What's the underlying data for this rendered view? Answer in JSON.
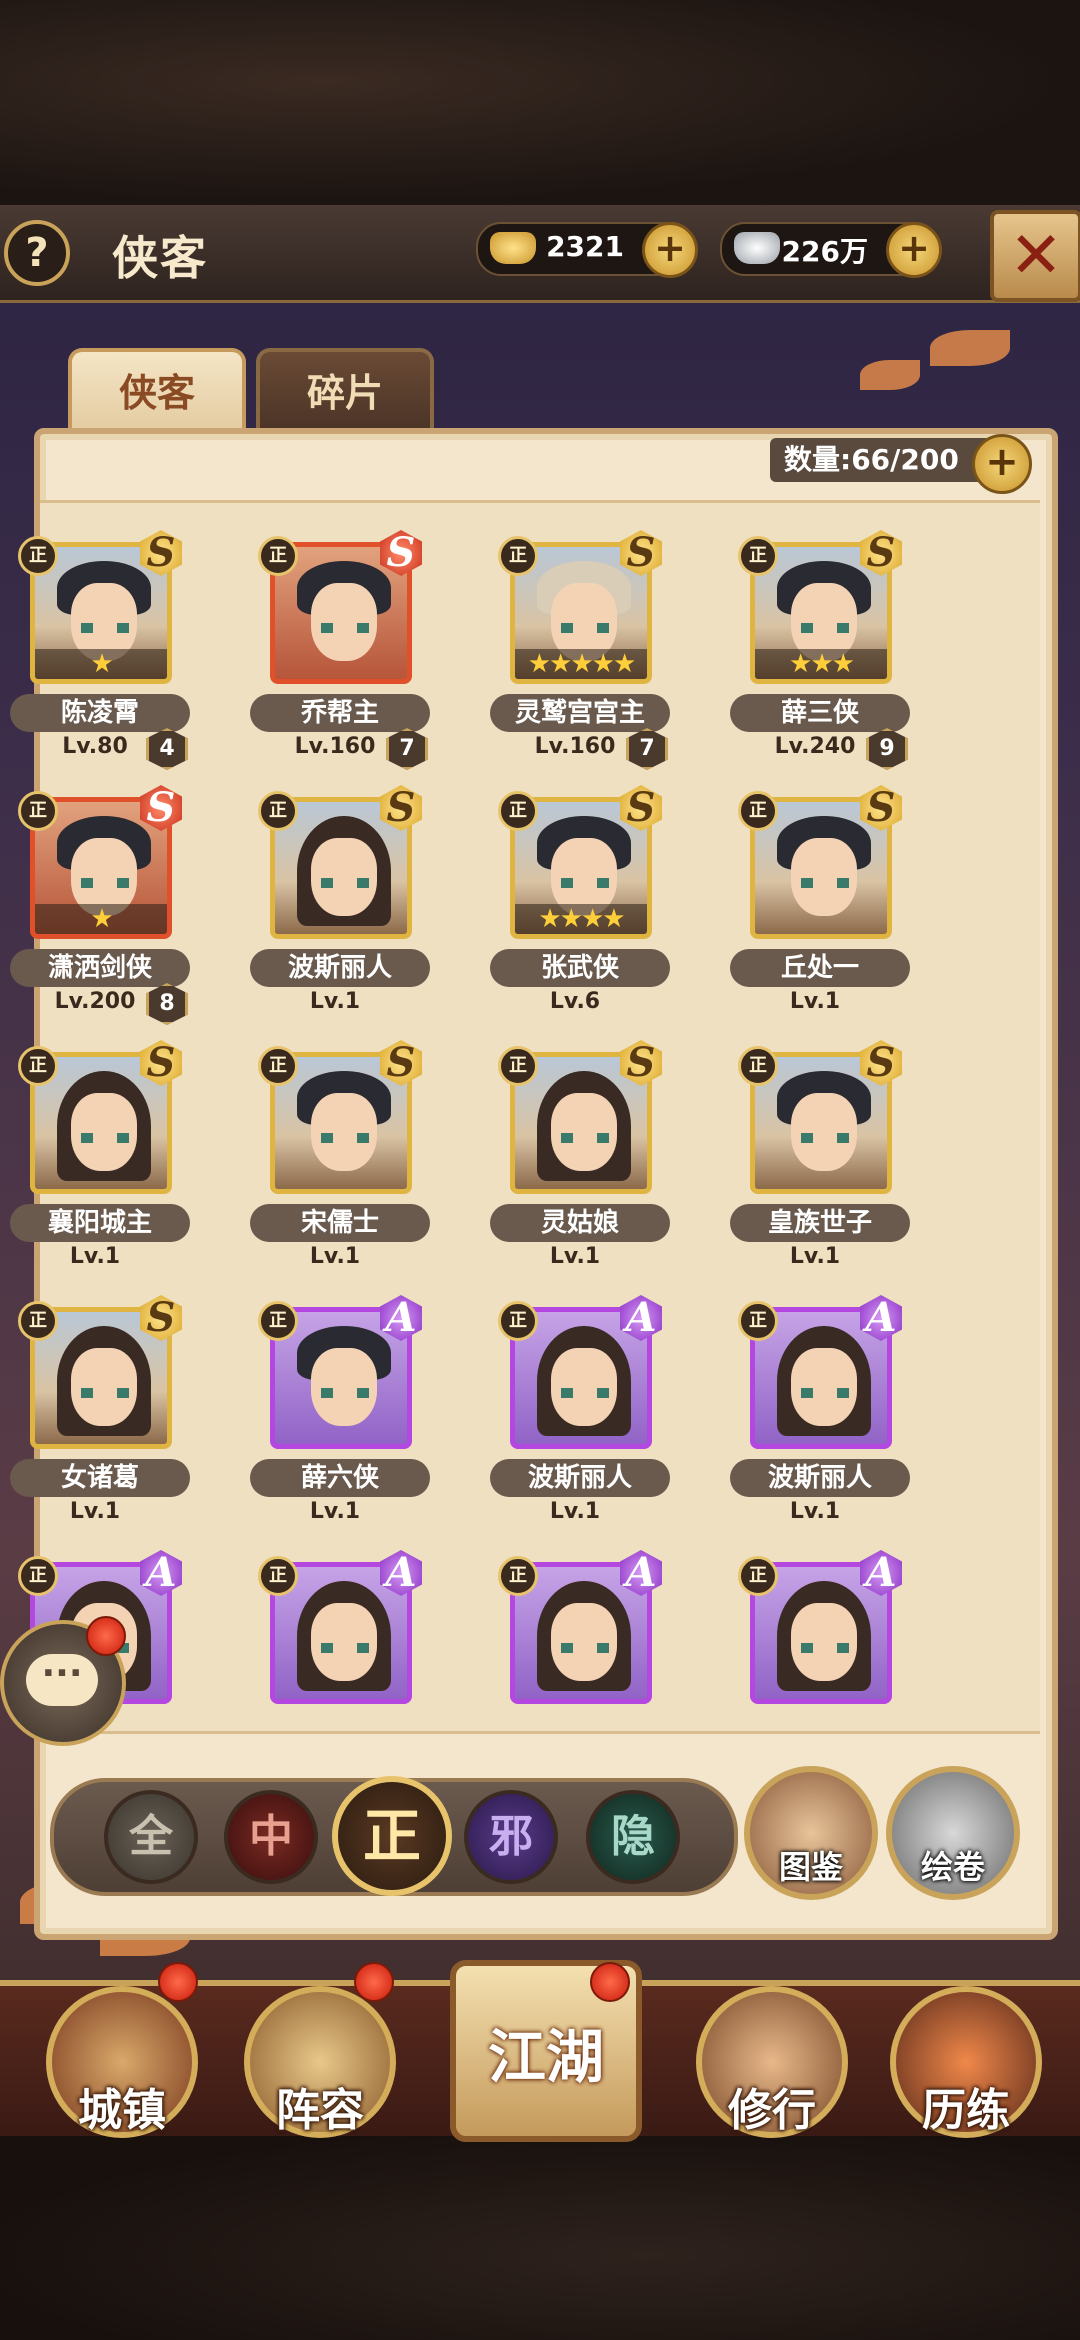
{
  "header": {
    "title": "侠客",
    "help_label": "?",
    "gold": "2321",
    "silver": "226万",
    "close_label": "✕"
  },
  "tabs": [
    {
      "label": "侠客",
      "active": true
    },
    {
      "label": "碎片",
      "active": false
    }
  ],
  "roster": {
    "count_text": "数量:66/200",
    "add_label": "+"
  },
  "heroes": [
    {
      "name": "陈凌霄",
      "level": "Lv.80",
      "count": "4",
      "rank": "S",
      "faction": "正",
      "stars": "★",
      "frame": "gold",
      "hair": "short"
    },
    {
      "name": "乔帮主",
      "level": "Lv.160",
      "count": "7",
      "rank": "S",
      "faction": "正",
      "stars": "",
      "frame": "red",
      "hair": "short"
    },
    {
      "name": "灵鹫宫宫主",
      "level": "Lv.160",
      "count": "7",
      "rank": "S",
      "faction": "正",
      "stars": "★★★★★",
      "frame": "gold",
      "hair": "bald"
    },
    {
      "name": "薛三侠",
      "level": "Lv.240",
      "count": "9",
      "rank": "S",
      "faction": "正",
      "stars": "★★★",
      "frame": "gold",
      "hair": "short"
    },
    {
      "name": "潇洒剑侠",
      "level": "Lv.200",
      "count": "8",
      "rank": "S",
      "faction": "正",
      "stars": "★",
      "frame": "red",
      "hair": "short"
    },
    {
      "name": "波斯丽人",
      "level": "Lv.1",
      "count": "",
      "rank": "S",
      "faction": "正",
      "stars": "",
      "frame": "gold",
      "hair": "long"
    },
    {
      "name": "张武侠",
      "level": "Lv.6",
      "count": "",
      "rank": "S",
      "faction": "正",
      "stars": "★★★★",
      "frame": "gold",
      "hair": "short"
    },
    {
      "name": "丘处一",
      "level": "Lv.1",
      "count": "",
      "rank": "S",
      "faction": "正",
      "stars": "",
      "frame": "gold",
      "hair": "short"
    },
    {
      "name": "襄阳城主",
      "level": "Lv.1",
      "count": "",
      "rank": "S",
      "faction": "正",
      "stars": "",
      "frame": "gold",
      "hair": "long"
    },
    {
      "name": "宋儒士",
      "level": "Lv.1",
      "count": "",
      "rank": "S",
      "faction": "正",
      "stars": "",
      "frame": "gold",
      "hair": "short"
    },
    {
      "name": "灵姑娘",
      "level": "Lv.1",
      "count": "",
      "rank": "S",
      "faction": "正",
      "stars": "",
      "frame": "gold",
      "hair": "long"
    },
    {
      "name": "皇族世子",
      "level": "Lv.1",
      "count": "",
      "rank": "S",
      "faction": "正",
      "stars": "",
      "frame": "gold",
      "hair": "short"
    },
    {
      "name": "女诸葛",
      "level": "Lv.1",
      "count": "",
      "rank": "S",
      "faction": "正",
      "stars": "",
      "frame": "gold",
      "hair": "long"
    },
    {
      "name": "薛六侠",
      "level": "Lv.1",
      "count": "",
      "rank": "A",
      "faction": "正",
      "stars": "",
      "frame": "purple",
      "hair": "short"
    },
    {
      "name": "波斯丽人",
      "level": "Lv.1",
      "count": "",
      "rank": "A",
      "faction": "正",
      "stars": "",
      "frame": "purple",
      "hair": "long"
    },
    {
      "name": "波斯丽人",
      "level": "Lv.1",
      "count": "",
      "rank": "A",
      "faction": "正",
      "stars": "",
      "frame": "purple",
      "hair": "long"
    },
    {
      "name": "",
      "level": "",
      "count": "",
      "rank": "A",
      "faction": "正",
      "stars": "",
      "frame": "purple",
      "hair": "long"
    },
    {
      "name": "",
      "level": "",
      "count": "",
      "rank": "A",
      "faction": "正",
      "stars": "",
      "frame": "purple",
      "hair": "long"
    },
    {
      "name": "",
      "level": "",
      "count": "",
      "rank": "A",
      "faction": "正",
      "stars": "",
      "frame": "purple",
      "hair": "long"
    },
    {
      "name": "",
      "level": "",
      "count": "",
      "rank": "A",
      "faction": "正",
      "stars": "",
      "frame": "purple",
      "hair": "long"
    }
  ],
  "filters": [
    {
      "label": "全",
      "color": "#c9c0b0",
      "bg": "#4a4238",
      "selected": false
    },
    {
      "label": "中",
      "color": "#e8a090",
      "bg": "#5a1e1e",
      "selected": false
    },
    {
      "label": "正",
      "color": "#ffe7a8",
      "bg": "#3a2a18",
      "selected": true
    },
    {
      "label": "邪",
      "color": "#c8b0f0",
      "bg": "#3a2a5a",
      "selected": false
    },
    {
      "label": "隐",
      "color": "#a8d8c8",
      "bg": "#1e3a34",
      "selected": false
    }
  ],
  "side_buttons": {
    "codex": "图鉴",
    "scroll": "绘卷"
  },
  "nav": {
    "town": "城镇",
    "lineup": "阵容",
    "jianghu": "江湖",
    "practice": "修行",
    "trials": "历练"
  },
  "colors": {
    "gold_frame": "#e0b440",
    "red_frame": "#e0502a",
    "purple_frame": "#b447e0",
    "badge": "#c81a0a"
  }
}
